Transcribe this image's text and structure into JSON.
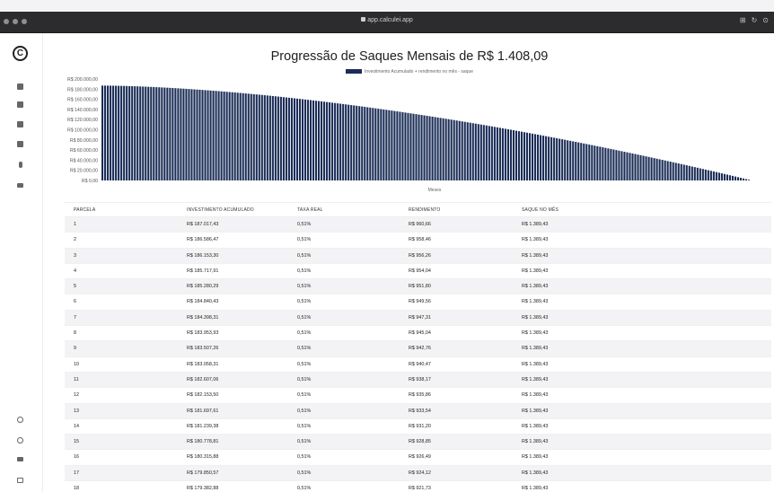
{
  "browser": {
    "url": "app.calculei.app"
  },
  "sidebar": {
    "logo": "C",
    "icons": [
      "chart-pie-icon",
      "calculator-icon",
      "briefcase-icon",
      "grid-icon",
      "microphone-icon",
      "users-icon"
    ],
    "bottom_icons": [
      "user-circle-icon",
      "whatsapp-icon",
      "handshake-icon",
      "book-icon"
    ]
  },
  "chart_data": {
    "type": "bar",
    "title": "Progressão de Saques Mensais de R$ 1.408,09",
    "legend": "Investimento Acumulado + rendimento no mês - saque",
    "xlabel": "Meses",
    "ylim": [
      0,
      200000
    ],
    "yticks": [
      "R$ 200.000,00",
      "R$ 180.000,00",
      "R$ 160.000,00",
      "R$ 140.000,00",
      "R$ 120.000,00",
      "R$ 100.000,00",
      "R$ 80.000,00",
      "R$ 60.000,00",
      "R$ 40.000,00",
      "R$ 20.000,00",
      "R$ 0,00"
    ],
    "series": [
      {
        "color": "#1b2d57",
        "count": 240,
        "start_value": 187017.43,
        "end_value": 1400
      }
    ]
  },
  "table": {
    "columns": [
      "PARCELA",
      "INVESTIMENTO ACUMULADO",
      "TAXA REAL",
      "RENDIMENTO",
      "SAQUE NO MÊS"
    ],
    "rows": [
      [
        "1",
        "R$ 187.017,43",
        "0,51%",
        "R$ 960,66",
        "R$ 1.389,43"
      ],
      [
        "2",
        "R$ 186.586,47",
        "0,51%",
        "R$ 958,46",
        "R$ 1.389,43"
      ],
      [
        "3",
        "R$ 186.153,30",
        "0,51%",
        "R$ 956,26",
        "R$ 1.389,43"
      ],
      [
        "4",
        "R$ 185.717,91",
        "0,51%",
        "R$ 954,04",
        "R$ 1.389,43"
      ],
      [
        "5",
        "R$ 185.280,29",
        "0,51%",
        "R$ 951,80",
        "R$ 1.389,43"
      ],
      [
        "6",
        "R$ 184.840,43",
        "0,51%",
        "R$ 949,56",
        "R$ 1.389,43"
      ],
      [
        "7",
        "R$ 184.398,31",
        "0,51%",
        "R$ 947,31",
        "R$ 1.389,43"
      ],
      [
        "8",
        "R$ 183.953,93",
        "0,51%",
        "R$ 945,04",
        "R$ 1.389,43"
      ],
      [
        "9",
        "R$ 183.507,26",
        "0,51%",
        "R$ 942,76",
        "R$ 1.389,43"
      ],
      [
        "10",
        "R$ 183.058,31",
        "0,51%",
        "R$ 940,47",
        "R$ 1.389,43"
      ],
      [
        "11",
        "R$ 182.607,06",
        "0,51%",
        "R$ 938,17",
        "R$ 1.389,43"
      ],
      [
        "12",
        "R$ 182.153,50",
        "0,51%",
        "R$ 935,86",
        "R$ 1.389,43"
      ],
      [
        "13",
        "R$ 181.697,61",
        "0,51%",
        "R$ 933,54",
        "R$ 1.389,43"
      ],
      [
        "14",
        "R$ 181.239,38",
        "0,51%",
        "R$ 931,20",
        "R$ 1.389,43"
      ],
      [
        "15",
        "R$ 180.778,81",
        "0,51%",
        "R$ 928,85",
        "R$ 1.389,43"
      ],
      [
        "16",
        "R$ 180.315,88",
        "0,51%",
        "R$ 926,49",
        "R$ 1.389,43"
      ],
      [
        "17",
        "R$ 179.850,57",
        "0,51%",
        "R$ 924,12",
        "R$ 1.389,43"
      ],
      [
        "18",
        "R$ 179.382,88",
        "0,51%",
        "R$ 921,73",
        "R$ 1.389,43"
      ]
    ]
  }
}
